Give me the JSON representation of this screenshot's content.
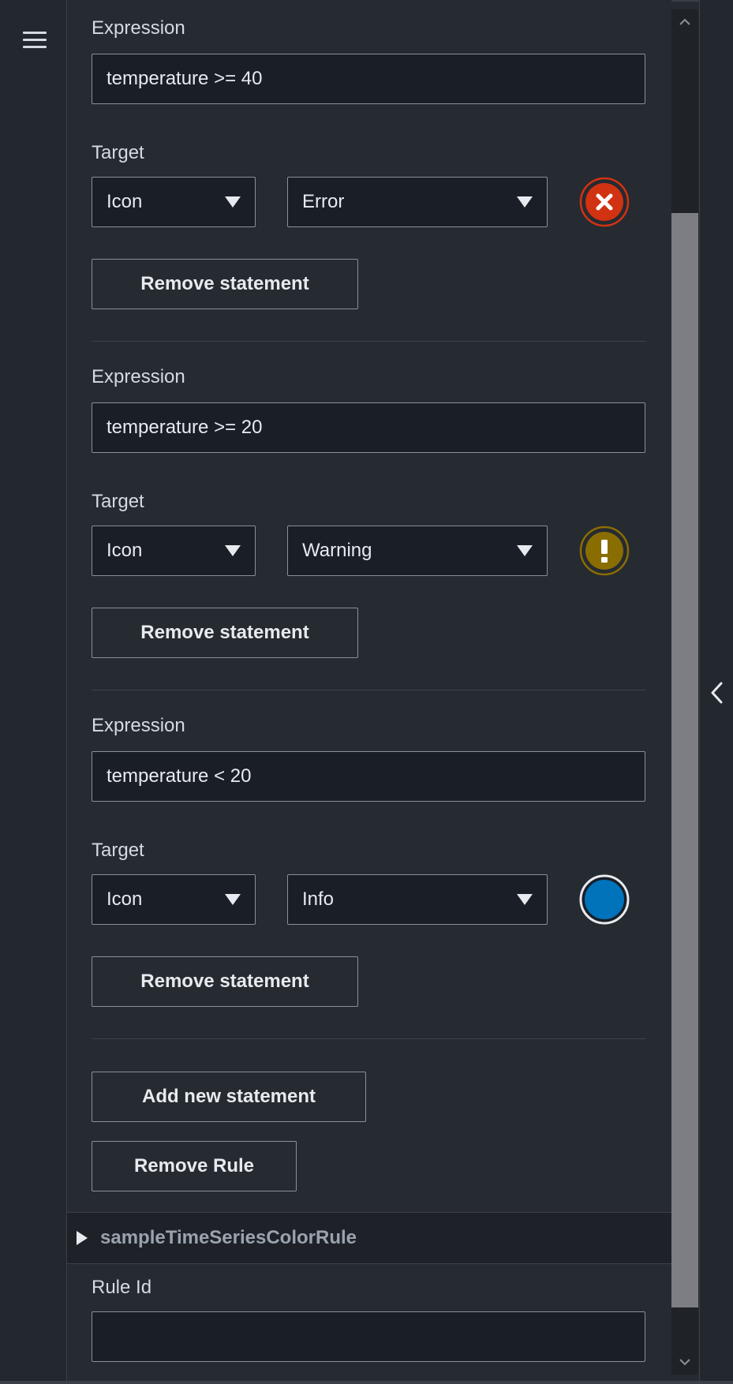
{
  "statements": [
    {
      "expression_label": "Expression",
      "expression_value": "temperature >= 40",
      "target_label": "Target",
      "target_type": "Icon",
      "target_value": "Error",
      "remove_label": "Remove statement"
    },
    {
      "expression_label": "Expression",
      "expression_value": "temperature >= 20",
      "target_label": "Target",
      "target_type": "Icon",
      "target_value": "Warning",
      "remove_label": "Remove statement"
    },
    {
      "expression_label": "Expression",
      "expression_value": "temperature < 20",
      "target_label": "Target",
      "target_type": "Icon",
      "target_value": "Info",
      "remove_label": "Remove statement"
    }
  ],
  "actions": {
    "add_statement_label": "Add new statement",
    "remove_rule_label": "Remove Rule"
  },
  "next_rule": {
    "name": "sampleTimeSeriesColorRule",
    "rule_id_label": "Rule Id",
    "rule_id_value": ""
  },
  "colors": {
    "error": "#d13212",
    "warning": "#8a6d00",
    "info": "#0073bb"
  },
  "icons": {
    "menu": "hamburger-menu-icon",
    "error": "error-x-circle-icon",
    "warning": "warning-exclamation-icon",
    "info": "info-dot-icon",
    "collapse": "chevron-left-icon",
    "expand": "caret-right-icon"
  }
}
